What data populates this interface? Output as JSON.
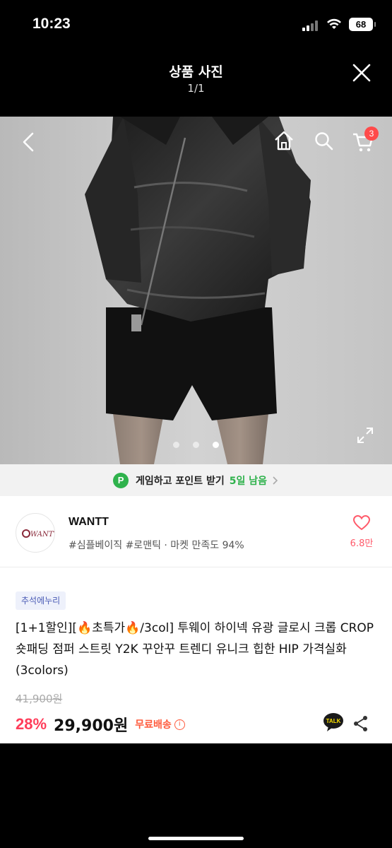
{
  "status_bar": {
    "time": "10:23",
    "battery": "68"
  },
  "viewer": {
    "title": "상품 사진",
    "count": "1/1"
  },
  "photo": {
    "cart_count": "3",
    "dots": 3
  },
  "game_banner": {
    "p": "P",
    "text": "게임하고 포인트 받기",
    "days": "5일 남음"
  },
  "seller": {
    "logo_text": "WANTT",
    "name": "WANTT",
    "tags": "#심플베이직 #로맨틱 · 마켓 만족도 94%",
    "likes": "6.8만"
  },
  "product": {
    "badge": "추석에누리",
    "title": "[1+1할인][🔥초특가🔥/3col] 투웨이 하이넥 유광 글로시 크롭 CROP 숏패딩 점퍼 스트릿 Y2K 꾸안꾸 트렌디 유니크 힙한 HIP 가격실화 (3colors)",
    "original_price": "41,900원",
    "discount": "28%",
    "price": "29,900원",
    "shipping": "무료배송",
    "info": "i",
    "talk": "TALK"
  },
  "colors": {
    "discount": "#ff3d5a",
    "shipping": "#ff5a3c",
    "point_green": "#2fb24c",
    "like": "#ff5a6a"
  }
}
